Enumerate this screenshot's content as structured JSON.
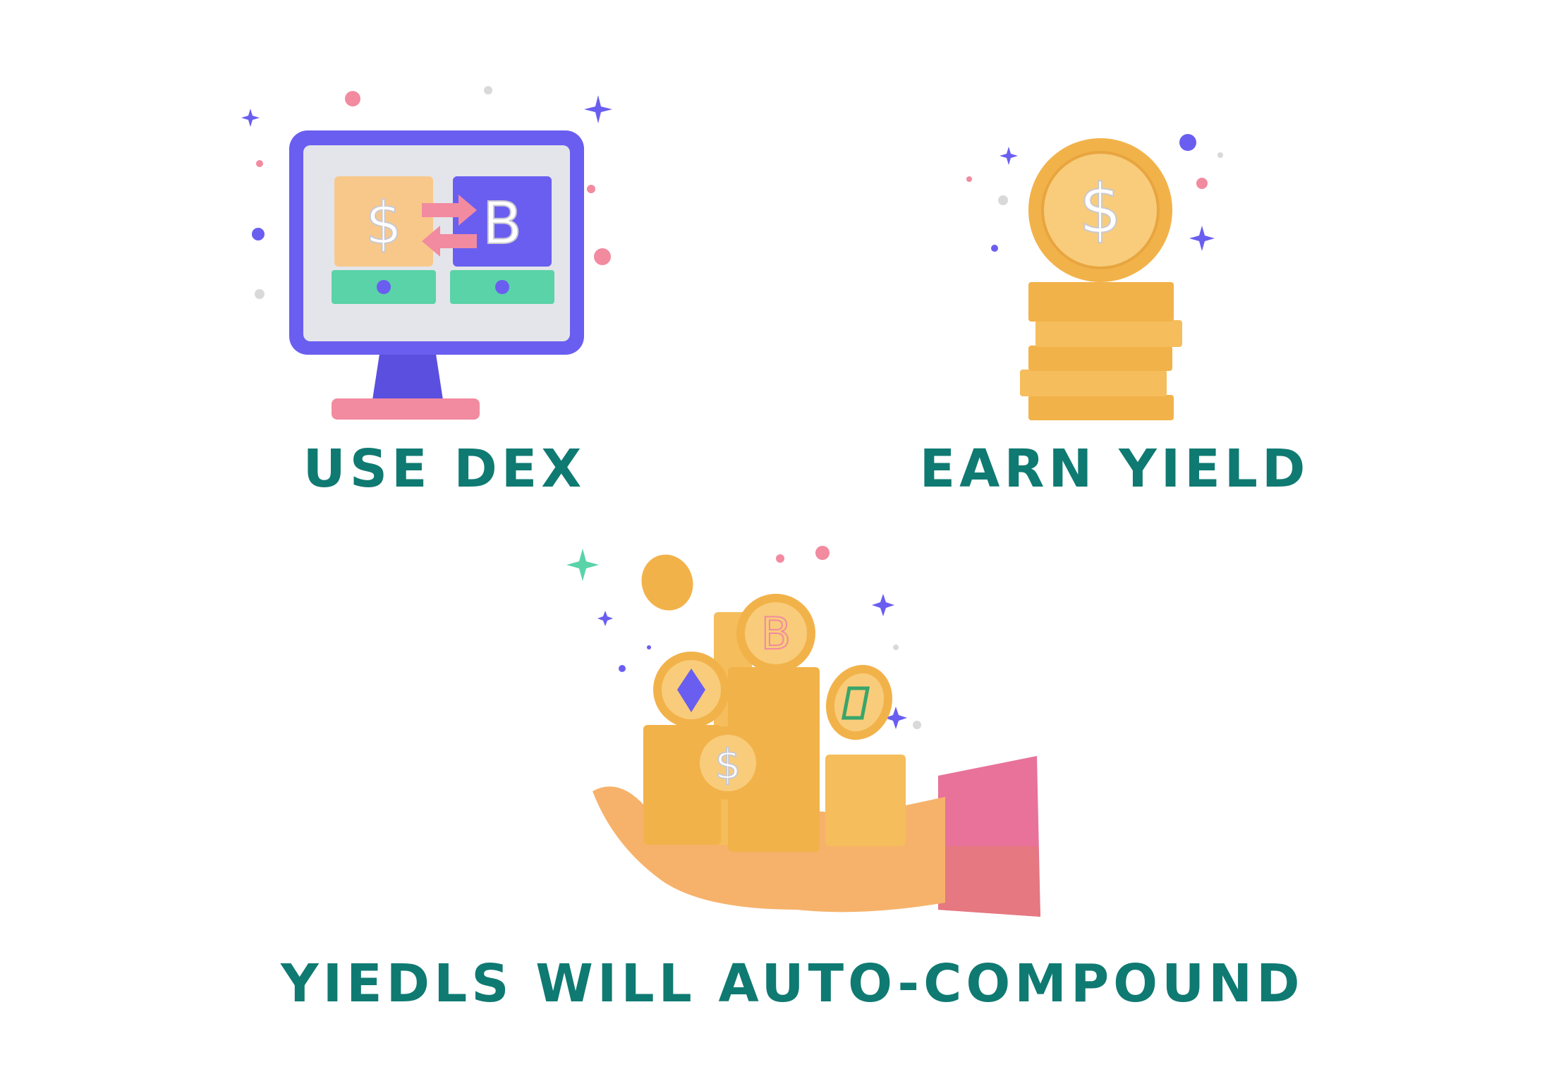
{
  "colors": {
    "caption": "#0f7a72",
    "monitor": "#6a5ef0",
    "screen": "#e4e5ea",
    "coin": "#f2b24a",
    "coin_light": "#f8cc7a",
    "pink": "#f28aa0",
    "green": "#5ad3a8",
    "sleeve": "#e8729a",
    "hand": "#f6b26b"
  },
  "sections": [
    {
      "caption": "USE DEX",
      "icon": "monitor-swap-icon"
    },
    {
      "caption": "EARN YIELD",
      "icon": "coin-stack-icon"
    },
    {
      "caption": "YIEDLS WILL AUTO-COMPOUND",
      "icon": "hand-holding-coins-icon"
    }
  ],
  "glyphs": {
    "dollar": "$",
    "bitcoin": "B"
  }
}
